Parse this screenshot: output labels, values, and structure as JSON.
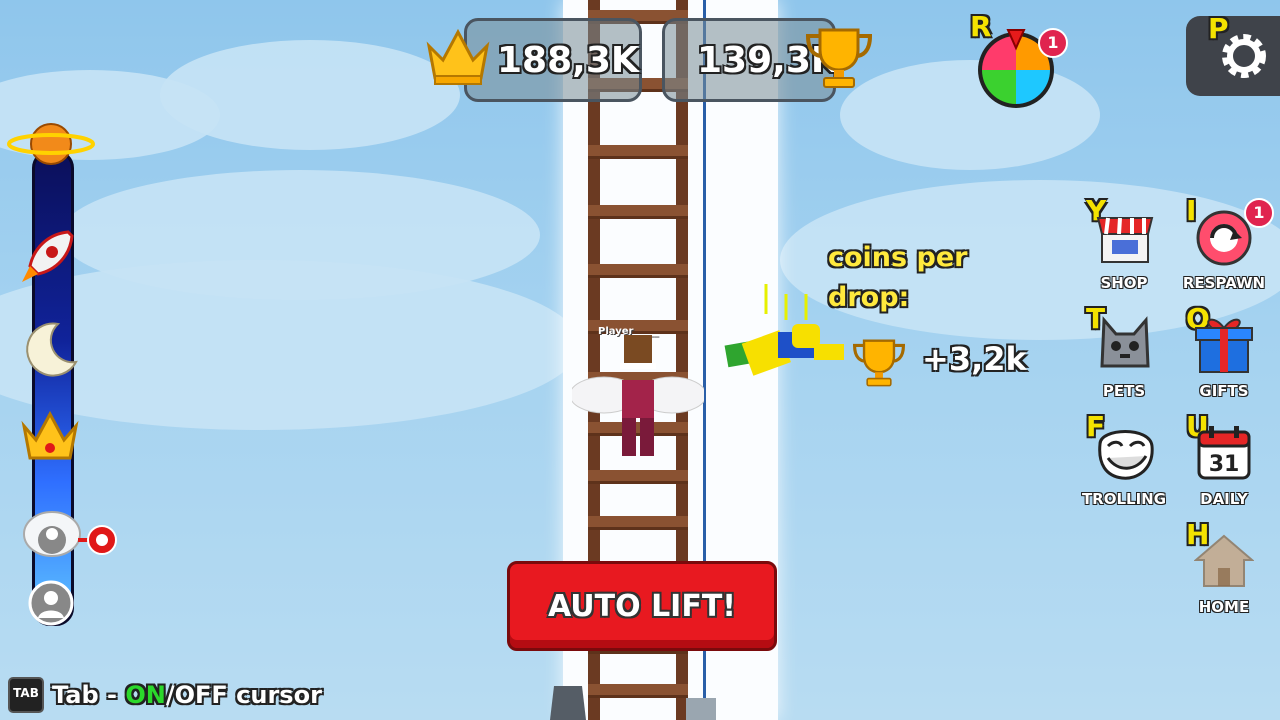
{
  "stats": {
    "crowns": "188,3K",
    "trophies": "139,3K"
  },
  "rewards": {
    "key": "R",
    "badge": "1"
  },
  "settings": {
    "key": "P"
  },
  "coins_per_drop": {
    "title_line1": "coins per",
    "title_line2": "drop:",
    "value": "+3,2k"
  },
  "player": {
    "name": "Player_____"
  },
  "auto_lift": {
    "label": "AUTO LIFT!"
  },
  "side_menu": [
    {
      "key": "Y",
      "label": "SHOP",
      "icon": "shop-icon"
    },
    {
      "key": "I",
      "label": "RESPAWN",
      "icon": "respawn-icon",
      "badge": "1"
    },
    {
      "key": "T",
      "label": "PETS",
      "icon": "pets-icon"
    },
    {
      "key": "O",
      "label": "GIFTS",
      "icon": "gift-icon"
    },
    {
      "key": "F",
      "label": "TROLLING",
      "icon": "troll-face-icon"
    },
    {
      "key": "U",
      "label": "DAILY",
      "icon": "calendar-icon",
      "day": "31"
    },
    {
      "key": "H",
      "label": "HOME",
      "icon": "home-icon"
    }
  ],
  "tab_hint": {
    "key": "TAB",
    "prefix": "Tab - ",
    "on": "ON",
    "suffix": "/OFF cursor"
  },
  "progress_bar": {
    "progress": 0.12,
    "milestones": [
      "planet-icon",
      "rocket-icon",
      "moon-icon",
      "crown-icon",
      "cloud-player-icon",
      "player-icon"
    ]
  },
  "colors": {
    "accent_button": "#e81920",
    "badge": "#e0244f",
    "key_letter": "#f4e200",
    "coins_title": "#ffe93d",
    "on_text": "#2bd82b"
  }
}
